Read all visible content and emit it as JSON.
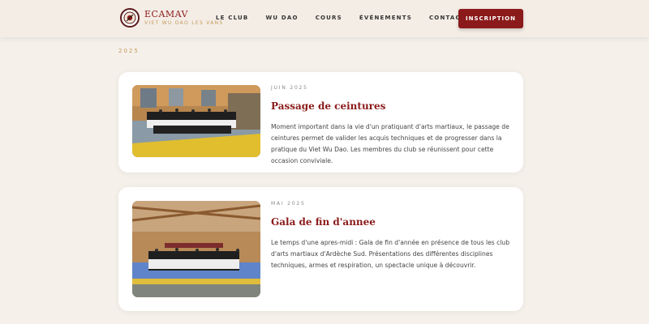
{
  "brand": {
    "name": "ECAMAV",
    "tagline": "VIET WU DAO LES VANS"
  },
  "nav": {
    "items": [
      "LE CLUB",
      "WU DAO",
      "COURS",
      "ÉVÉNEMENTS",
      "CONTACT"
    ],
    "cta_label": "INSCRIPTION"
  },
  "section": {
    "year": "2025"
  },
  "events": [
    {
      "date": "JUIN 2025",
      "title": "Passage de ceintures",
      "description": "Moment important dans la vie d'un pratiquant d'arts martiaux, le passage de ceintures permet de valider les acquis techniques et de progresser dans la pratique du Viet Wu Dao. Les membres du club se réunissent pour cette occasion conviviale."
    },
    {
      "date": "MAI 2025",
      "title": "Gala de fin d'annee",
      "description": "Le temps d'une apres-midi : Gala de fin d'année en présence de tous les club d'arts martiaux d'Ardèche Sud. Présentations des différentes disciplines techniques, armes et respiration, un spectacle unique à découvrir."
    }
  ],
  "colors": {
    "brand": "#8b1a1a",
    "accent": "#c49a5c",
    "background": "#f5f0ea"
  }
}
